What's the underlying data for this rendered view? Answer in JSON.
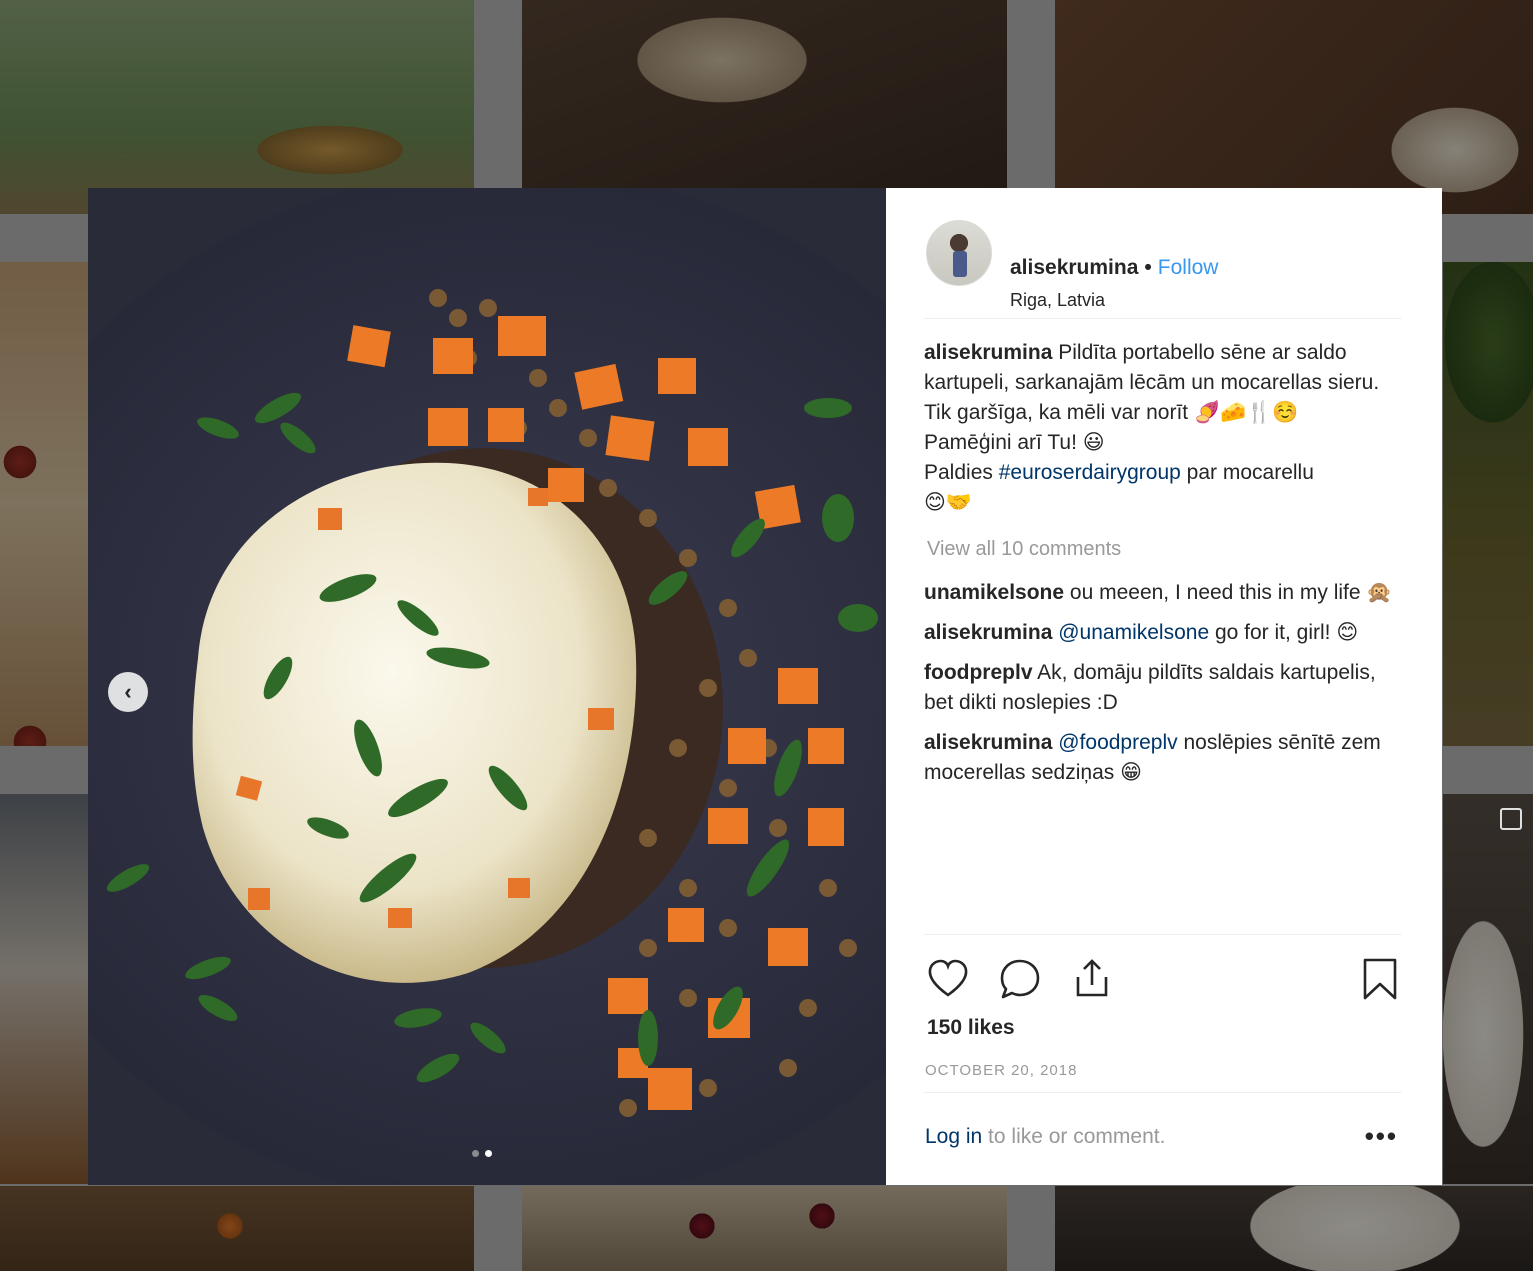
{
  "post": {
    "username": "alisekrumina",
    "separator": "•",
    "follow_label": "Follow",
    "location": "Riga, Latvia",
    "caption": {
      "username": "alisekrumina",
      "line1": " Pildīta portabello sēne ar saldo kartupeli, sarkanajām lēcām un mocarellas sieru. Tik garšīga, ka mēli var norīt 🍠🧀🍴☺️",
      "line2": "Pamēģini arī Tu! 😃",
      "line3_prefix": "Paldies ",
      "hashtag": "#euroserdairygroup",
      "line3_suffix": " par mocarellu",
      "line4": "😊🤝"
    },
    "view_all_comments": "View all 10 comments",
    "replies": [
      {
        "username": "unamikelsone",
        "mention": "",
        "text": " ou meeen, I need this in my life 🙊"
      },
      {
        "username": "alisekrumina",
        "mention": " @unamikelsone",
        "text": " go for it, girl! 😊"
      },
      {
        "username": "foodpreplv",
        "mention": "",
        "text": " Ak, domāju pildīts saldais kartupelis, bet dikti noslepies :D"
      },
      {
        "username": "alisekrumina",
        "mention": " @foodpreplv",
        "text": " noslēpies sēnītē zem mocerellas sedziņas 😁"
      }
    ],
    "likes": "150 likes",
    "date": "OCTOBER 20, 2018",
    "login_link": "Log in",
    "login_rest": " to like or comment.",
    "more_label": "•••",
    "carousel": {
      "current": 2,
      "total": 2
    }
  },
  "icons": {
    "nav_prev": "chevron-left-icon",
    "like": "heart-icon",
    "comment": "comment-icon",
    "share": "share-icon",
    "save": "bookmark-icon"
  },
  "colors": {
    "link": "#3897f0",
    "hashtag": "#003569",
    "text": "#262626",
    "muted": "#999999"
  }
}
